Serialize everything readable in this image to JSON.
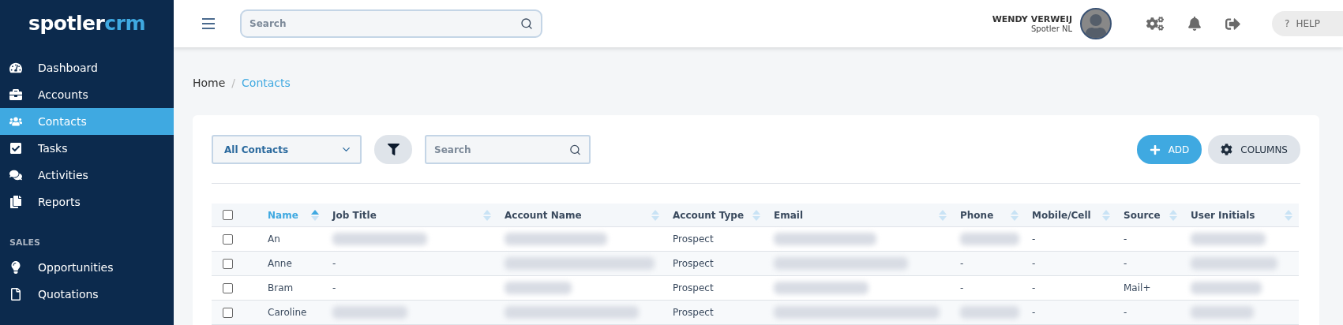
{
  "logo": {
    "main": "spotler",
    "accent": "crm"
  },
  "sidebar": {
    "items": [
      {
        "label": "Dashboard",
        "selected": false
      },
      {
        "label": "Accounts",
        "selected": false
      },
      {
        "label": "Contacts",
        "selected": true
      },
      {
        "label": "Tasks",
        "selected": false
      },
      {
        "label": "Activities",
        "selected": false
      },
      {
        "label": "Reports",
        "selected": false
      }
    ],
    "sections": [
      {
        "title": "SALES",
        "items": [
          {
            "label": "Opportunities",
            "selected": false
          },
          {
            "label": "Quotations",
            "selected": false
          }
        ]
      }
    ]
  },
  "topbar": {
    "search": {
      "placeholder": "Search"
    },
    "user": {
      "name": "WENDY VERWEIJ",
      "company": "Spotler NL"
    },
    "help": {
      "glyph": "?",
      "label": "HELP"
    }
  },
  "breadcrumb": {
    "separator": "/",
    "items": [
      {
        "label": "Home",
        "current": false
      },
      {
        "label": "Contacts",
        "current": true
      }
    ]
  },
  "toolbar": {
    "view": "All Contacts",
    "search": {
      "placeholder": "Search"
    },
    "add": "ADD",
    "columns": "COLUMNS"
  },
  "table": {
    "all_checked": false,
    "columns": [
      {
        "label": "Name",
        "sorted": true
      },
      {
        "label": "Job Title",
        "sorted": false
      },
      {
        "label": "Account Name",
        "sorted": false
      },
      {
        "label": "Account Type",
        "sorted": false
      },
      {
        "label": "Email",
        "sorted": false
      },
      {
        "label": "Phone",
        "sorted": false
      },
      {
        "label": "Mobile/Cell",
        "sorted": false
      },
      {
        "label": "Source",
        "sorted": false
      },
      {
        "label": "User Initials",
        "sorted": false
      }
    ],
    "rows": [
      {
        "checked": false,
        "cells": [
          {
            "kind": "text",
            "text": "An"
          },
          {
            "kind": "blurred"
          },
          {
            "kind": "blurred"
          },
          {
            "kind": "text",
            "text": "Prospect"
          },
          {
            "kind": "blurred"
          },
          {
            "kind": "blurred"
          },
          {
            "kind": "text",
            "text": "-"
          },
          {
            "kind": "text",
            "text": "-"
          },
          {
            "kind": "blurred"
          }
        ]
      },
      {
        "checked": false,
        "cells": [
          {
            "kind": "text",
            "text": "Anne"
          },
          {
            "kind": "text",
            "text": "-"
          },
          {
            "kind": "blurred"
          },
          {
            "kind": "text",
            "text": "Prospect"
          },
          {
            "kind": "blurred"
          },
          {
            "kind": "text",
            "text": "-"
          },
          {
            "kind": "text",
            "text": "-"
          },
          {
            "kind": "text",
            "text": "-"
          },
          {
            "kind": "blurred"
          }
        ]
      },
      {
        "checked": false,
        "cells": [
          {
            "kind": "text",
            "text": "Bram"
          },
          {
            "kind": "text",
            "text": "-"
          },
          {
            "kind": "blurred"
          },
          {
            "kind": "text",
            "text": "Prospect"
          },
          {
            "kind": "blurred"
          },
          {
            "kind": "text",
            "text": "-"
          },
          {
            "kind": "text",
            "text": "-"
          },
          {
            "kind": "text",
            "text": "Mail+"
          },
          {
            "kind": "blurred"
          }
        ]
      },
      {
        "checked": false,
        "cells": [
          {
            "kind": "text",
            "text": "Caroline"
          },
          {
            "kind": "blurred"
          },
          {
            "kind": "blurred"
          },
          {
            "kind": "text",
            "text": "Prospect"
          },
          {
            "kind": "blurred"
          },
          {
            "kind": "blurred"
          },
          {
            "kind": "text",
            "text": "-"
          },
          {
            "kind": "text",
            "text": "-"
          },
          {
            "kind": "blurred"
          }
        ]
      }
    ]
  }
}
